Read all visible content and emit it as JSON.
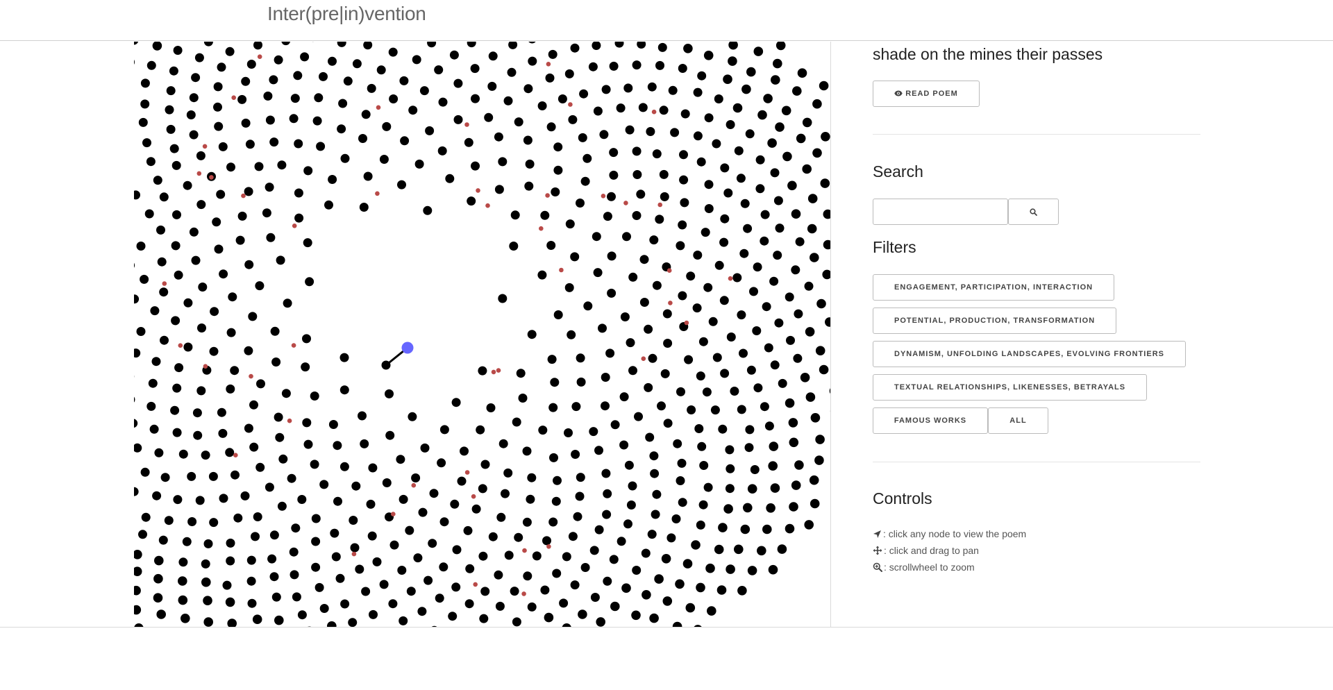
{
  "header": {
    "brand": "Inter(pre|in)vention"
  },
  "poem": {
    "title": "shade on the mines their passes",
    "read_label": "READ POEM",
    "read_icon": "eye-icon"
  },
  "search": {
    "heading": "Search",
    "value": "",
    "placeholder": "",
    "button_icon": "search-icon"
  },
  "filters": {
    "heading": "Filters",
    "items": [
      "ENGAGEMENT, PARTICIPATION, INTERACTION",
      "POTENTIAL, PRODUCTION, TRANSFORMATION",
      "DYNAMISM, UNFOLDING LANDSCAPES, EVOLVING FRONTIERS",
      "TEXTUAL RELATIONSHIPS, LIKENESSES, BETRAYALS",
      "FAMOUS WORKS",
      "ALL"
    ]
  },
  "controls": {
    "heading": "Controls",
    "items": [
      {
        "icon": "location-arrow-icon",
        "text": ": click any node to view the poem"
      },
      {
        "icon": "move-icon",
        "text": ": click and drag to pan"
      },
      {
        "icon": "zoom-in-icon",
        "text": ": scrollwheel to zoom"
      }
    ]
  },
  "graph": {
    "node_color": "#000000",
    "highlight_color": "#b94a48",
    "selected_color": "#6666ff",
    "edge_color": "#000000"
  }
}
